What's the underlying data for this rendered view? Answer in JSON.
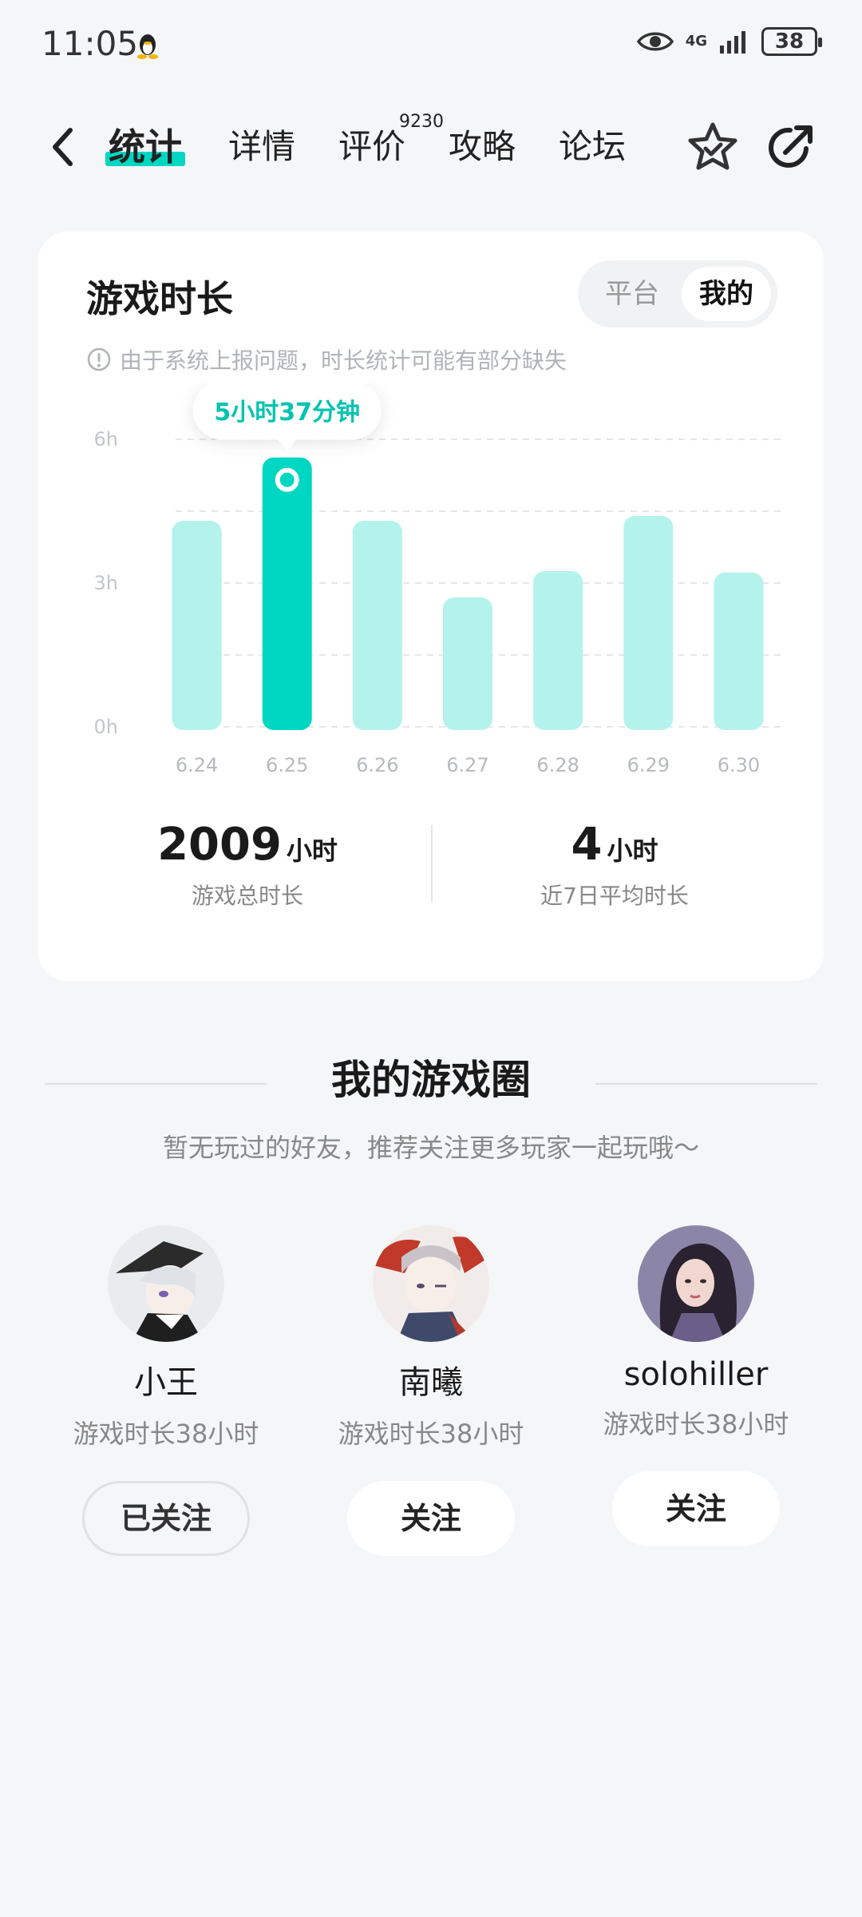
{
  "status_bar": {
    "time": "11:05",
    "network": "4G",
    "battery": "38"
  },
  "nav": {
    "tabs": [
      {
        "label": "统计",
        "active": true
      },
      {
        "label": "详情",
        "active": false
      },
      {
        "label": "评价",
        "active": false
      },
      {
        "label": "攻略",
        "active": false
      },
      {
        "label": "论坛",
        "active": false
      }
    ],
    "review_badge": "9230"
  },
  "playtime_card": {
    "title": "游戏时长",
    "toggle": {
      "options": [
        "平台",
        "我的"
      ],
      "selected": "我的"
    },
    "notice": "由于系统上报问题，时长统计可能有部分缺失",
    "tooltip": "5小时37分钟",
    "total": {
      "value": "2009",
      "unit": "小时",
      "label": "游戏总时长"
    },
    "average": {
      "value": "4",
      "unit": "小时",
      "label": "近7日平均时长"
    }
  },
  "chart_data": {
    "type": "bar",
    "categories": [
      "6.24",
      "6.25",
      "6.26",
      "6.27",
      "6.28",
      "6.29",
      "6.30"
    ],
    "values": [
      4.3,
      5.62,
      4.3,
      2.7,
      3.25,
      4.4,
      3.22
    ],
    "ylim": [
      0,
      6
    ],
    "y_ticks": [
      "0h",
      "3h",
      "6h"
    ],
    "highlight_index": 1,
    "colors": {
      "bar": "#b3f3ec",
      "highlight": "#00d7c3",
      "tooltip_text": "#00c4b0"
    },
    "grid": true
  },
  "game_circle": {
    "title": "我的游戏圈",
    "subtitle": "暂无玩过的好友，推荐关注更多玩家一起玩哦～",
    "friends": [
      {
        "name": "小王",
        "time": "游戏时长38小时",
        "button": "已关注",
        "followed": true
      },
      {
        "name": "南曦",
        "time": "游戏时长38小时",
        "button": "关注",
        "followed": false
      },
      {
        "name": "solohiller",
        "time": "游戏时长38小时",
        "button": "关注",
        "followed": false
      }
    ]
  },
  "colors": {
    "accent": "#00d7c3",
    "background": "#f5f6f8"
  }
}
